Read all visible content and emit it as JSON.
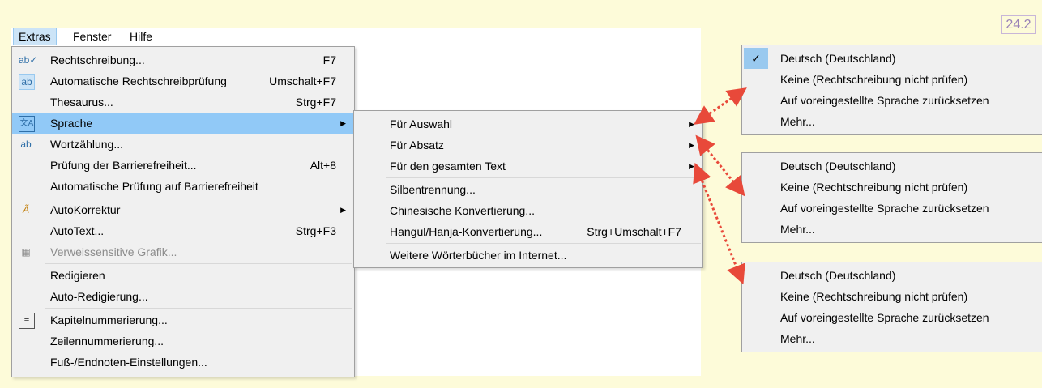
{
  "badge": "24.2",
  "menubar": {
    "items": [
      "Extras",
      "Fenster",
      "Hilfe"
    ]
  },
  "extras_menu": {
    "items": [
      {
        "label": "Rechtschreibung...",
        "shortcut": "F7",
        "icon": "spellcheck-icon",
        "glyph": "ab✓"
      },
      {
        "label": "Automatische Rechtschreibprüfung",
        "shortcut": "Umschalt+F7",
        "icon": "auto-spellcheck-icon",
        "glyph": "ab"
      },
      {
        "label": "Thesaurus...",
        "shortcut": "Strg+F7",
        "icon": "",
        "glyph": ""
      },
      {
        "label": "Sprache",
        "shortcut": "",
        "icon": "language-icon",
        "glyph": "文A",
        "submenu": true,
        "highlighted": true
      },
      {
        "label": "Wortzählung...",
        "shortcut": "",
        "icon": "word-count-icon",
        "glyph": "ab"
      },
      {
        "label": "Prüfung der Barrierefreiheit...",
        "shortcut": "Alt+8",
        "icon": "",
        "glyph": ""
      },
      {
        "label": "Automatische Prüfung auf Barrierefreiheit",
        "shortcut": "",
        "icon": "",
        "glyph": ""
      },
      {
        "label": "AutoKorrektur",
        "shortcut": "",
        "icon": "autocorrect-icon",
        "glyph": "Ã",
        "submenu": true
      },
      {
        "label": "AutoText...",
        "shortcut": "Strg+F3",
        "icon": "",
        "glyph": ""
      },
      {
        "label": "Verweissensitive Grafik...",
        "shortcut": "",
        "icon": "image-map-icon",
        "glyph": "▦",
        "disabled": true
      },
      {
        "label": "Redigieren",
        "shortcut": "",
        "icon": "",
        "glyph": ""
      },
      {
        "label": "Auto-Redigierung...",
        "shortcut": "",
        "icon": "",
        "glyph": ""
      },
      {
        "label": "Kapitelnummerierung...",
        "shortcut": "",
        "icon": "chapter-numbering-icon",
        "glyph": "≡"
      },
      {
        "label": "Zeilennummerierung...",
        "shortcut": "",
        "icon": "",
        "glyph": ""
      },
      {
        "label": "Fuß-/Endnoten-Einstellungen...",
        "shortcut": "",
        "icon": "",
        "glyph": ""
      }
    ]
  },
  "sprache_submenu": {
    "items": [
      {
        "label": "Für Auswahl",
        "shortcut": "",
        "submenu": true
      },
      {
        "label": "Für Absatz",
        "shortcut": "",
        "submenu": true
      },
      {
        "label": "Für den gesamten Text",
        "shortcut": "",
        "submenu": true
      },
      {
        "label": "Silbentrennung...",
        "shortcut": ""
      },
      {
        "label": "Chinesische Konvertierung...",
        "shortcut": ""
      },
      {
        "label": "Hangul/Hanja-Konvertierung...",
        "shortcut": "Strg+Umschalt+F7"
      },
      {
        "label": "Weitere Wörterbücher im Internet...",
        "shortcut": ""
      }
    ]
  },
  "language_menus": [
    {
      "items": [
        "Deutsch (Deutschland)",
        "Keine (Rechtschreibung nicht prüfen)",
        "Auf voreingestellte Sprache zurücksetzen",
        "Mehr..."
      ],
      "checked": true
    },
    {
      "items": [
        "Deutsch (Deutschland)",
        "Keine (Rechtschreibung nicht prüfen)",
        "Auf voreingestellte Sprache zurücksetzen",
        "Mehr..."
      ],
      "checked": false
    },
    {
      "items": [
        "Deutsch (Deutschland)",
        "Keine (Rechtschreibung nicht prüfen)",
        "Auf voreingestellte Sprache zurücksetzen",
        "Mehr..."
      ],
      "checked": false
    }
  ],
  "colors": {
    "background": "#fdfbd9",
    "highlight": "#91c9f7",
    "arrow": "#e8493a",
    "badge": "#9a83b8"
  }
}
